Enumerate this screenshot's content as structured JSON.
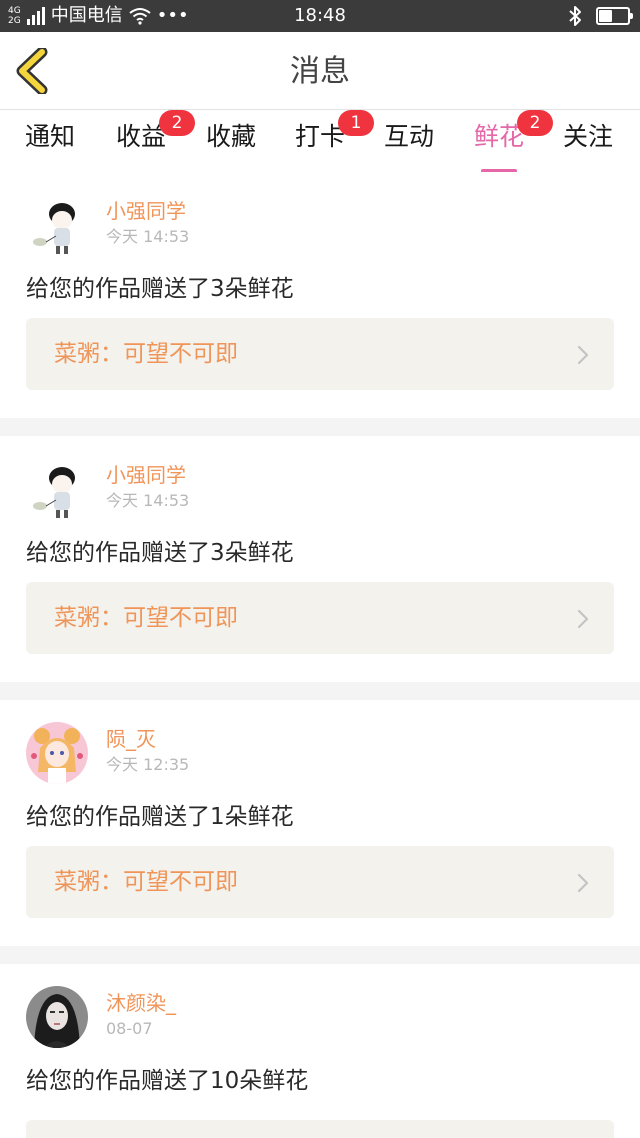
{
  "status_bar": {
    "network_top": "4G",
    "network_bottom": "2G",
    "carrier": "中国电信",
    "dots": "•••",
    "time": "18:48",
    "bluetooth_icon": "bluetooth-icon",
    "battery_level_fraction": 0.5
  },
  "nav": {
    "back_icon": "chevron-left-icon",
    "title": "消息",
    "accent_color": "#f5d53c"
  },
  "tabs": [
    {
      "label": "通知",
      "badge": ""
    },
    {
      "label": "收益",
      "badge": "2"
    },
    {
      "label": "收藏",
      "badge": ""
    },
    {
      "label": "打卡",
      "badge": "1"
    },
    {
      "label": "互动",
      "badge": ""
    },
    {
      "label": "鲜花",
      "badge": "2",
      "active": true
    },
    {
      "label": "关注",
      "badge": ""
    }
  ],
  "colors": {
    "active_tab": "#e567a8",
    "badge": "#f0343f",
    "name_text": "#f0955a",
    "link_bg": "#f3f2ec"
  },
  "messages": [
    {
      "user": "小强同学",
      "time": "今天 14:53",
      "text": "给您的作品赠送了3朵鲜花",
      "work": "菜粥：可望不可即",
      "avatar": "cartoon-boy-avatar"
    },
    {
      "user": "小强同学",
      "time": "今天 14:53",
      "text": "给您的作品赠送了3朵鲜花",
      "work": "菜粥：可望不可即",
      "avatar": "cartoon-boy-avatar"
    },
    {
      "user": "陨_灭",
      "time": "今天 12:35",
      "text": "给您的作品赠送了1朵鲜花",
      "work": "菜粥：可望不可即",
      "avatar": "anime-girl-avatar"
    },
    {
      "user": "沐颜染_",
      "time": "08-07",
      "text": "给您的作品赠送了10朵鲜花",
      "work": "",
      "avatar": "photo-girl-avatar"
    }
  ]
}
